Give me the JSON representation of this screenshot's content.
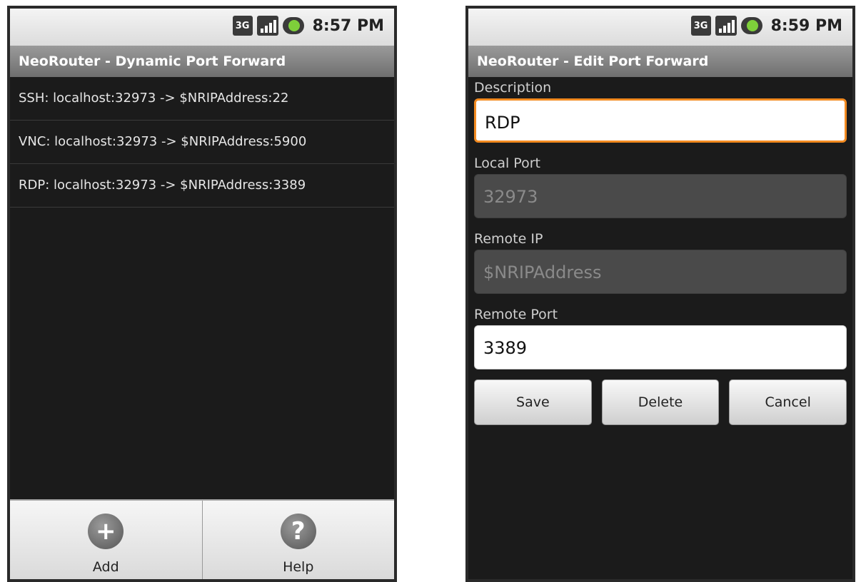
{
  "left_screen": {
    "status": {
      "network": "3G",
      "time": "8:57 PM"
    },
    "title": "NeoRouter - Dynamic Port Forward",
    "items": [
      "SSH: localhost:32973 -> $NRIPAddress:22",
      "VNC: localhost:32973 -> $NRIPAddress:5900",
      "RDP: localhost:32973 -> $NRIPAddress:3389"
    ],
    "menu": {
      "add_label": "Add",
      "help_label": "Help",
      "add_icon": "+",
      "help_icon": "?"
    }
  },
  "right_screen": {
    "status": {
      "network": "3G",
      "time": "8:59 PM"
    },
    "title": "NeoRouter - Edit Port Forward",
    "fields": {
      "description": {
        "label": "Description",
        "value": "RDP"
      },
      "local_port": {
        "label": "Local Port",
        "value": "32973"
      },
      "remote_ip": {
        "label": "Remote IP",
        "value": "$NRIPAddress"
      },
      "remote_port": {
        "label": "Remote Port",
        "value": "3389"
      }
    },
    "buttons": {
      "save": "Save",
      "delete": "Delete",
      "cancel": "Cancel"
    }
  },
  "colors": {
    "focus_border": "#f28a20",
    "background": "#1b1b1b"
  }
}
